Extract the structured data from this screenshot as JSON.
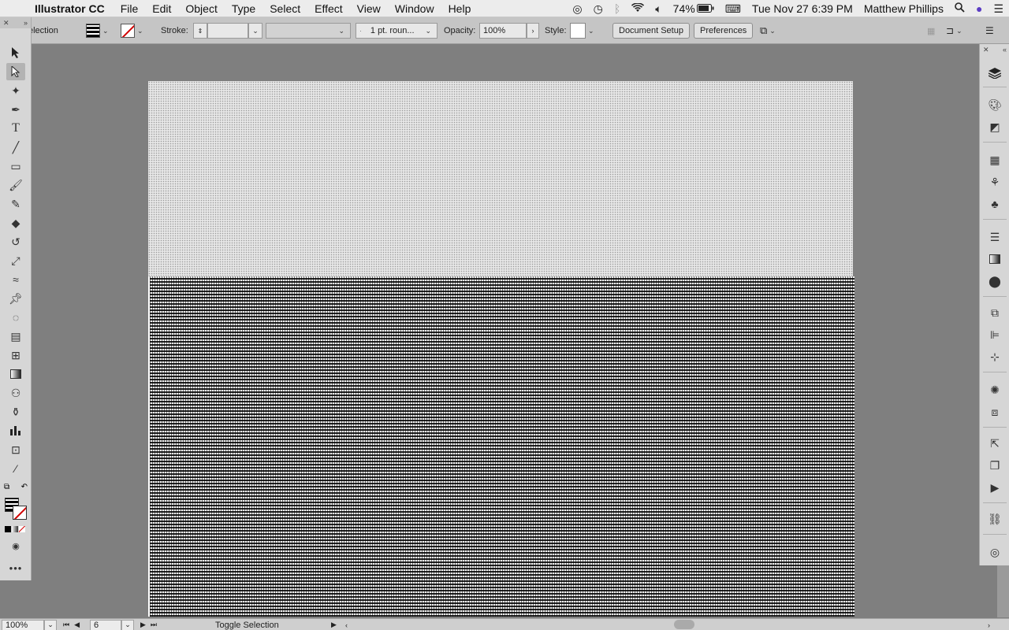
{
  "menubar": {
    "app_name": "Illustrator CC",
    "menus": [
      "File",
      "Edit",
      "Object",
      "Type",
      "Select",
      "Effect",
      "View",
      "Window",
      "Help"
    ],
    "battery": "74%",
    "datetime": "Tue Nov 27  6:39 PM",
    "user": "Matthew Phillips"
  },
  "controlbar": {
    "selection_label": "election",
    "stroke_label": "Stroke:",
    "stroke_profile": "1 pt. roun...",
    "opacity_label": "Opacity:",
    "opacity_value": "100%",
    "style_label": "Style:",
    "document_setup": "Document Setup",
    "preferences": "Preferences"
  },
  "statusbar": {
    "zoom": "100%",
    "artboard_number": "6",
    "status_text": "Toggle Selection"
  },
  "icons": {
    "apple": "apple-icon",
    "search": "search-icon",
    "wifi": "wifi-icon",
    "volume": "volume-icon",
    "battery": "battery-icon",
    "timemachine": "time-machine-icon",
    "bluetooth": "bluetooth-icon",
    "list": "list-icon"
  }
}
